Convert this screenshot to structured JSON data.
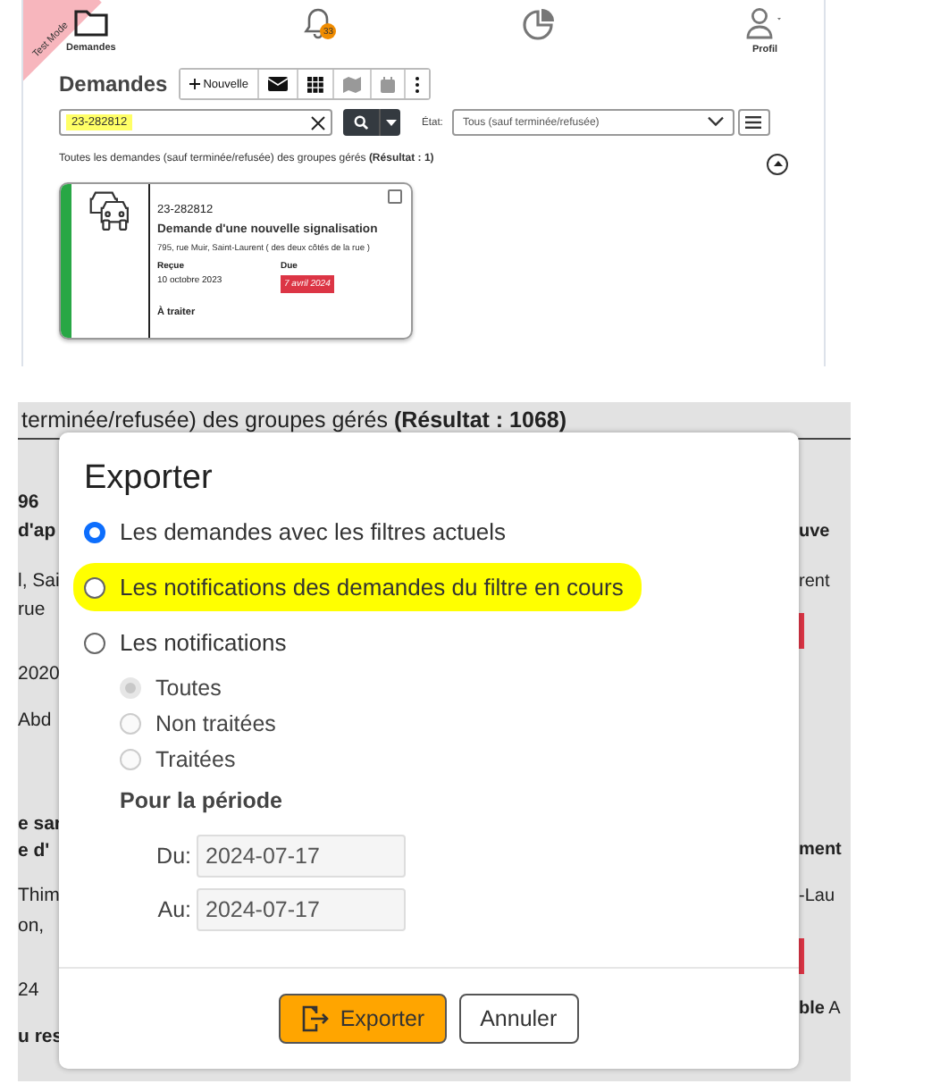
{
  "top_screen": {
    "test_mode_ribbon": "Test Mode",
    "nav": [
      {
        "kind": "folder",
        "label": "Demandes"
      },
      {
        "kind": "bell",
        "badge": "33"
      },
      {
        "kind": "chart"
      },
      {
        "kind": "user",
        "label": "Profil"
      }
    ],
    "heading": "Demandes",
    "toolbar": [
      {
        "kind": "new",
        "label": "Nouvelle",
        "disabled": false
      },
      {
        "kind": "mail",
        "disabled": false
      },
      {
        "kind": "grid",
        "disabled": false
      },
      {
        "kind": "map",
        "disabled": true
      },
      {
        "kind": "calendar",
        "disabled": true
      },
      {
        "kind": "more",
        "disabled": false
      }
    ],
    "search": {
      "value": "23-282812",
      "highlighted": true
    },
    "state_filter": {
      "label": "État:",
      "value": "Tous (sauf terminée/refusée)"
    },
    "summary": "Toutes les demandes (sauf terminée/refusée) des groupes gérés **(Résultat : 1)**",
    "cards": [
      {
        "number": "23-282812",
        "title": "Demande d'une nouvelle signalisation",
        "address": "795, rue Muir, Saint-Laurent ( des deux côtés de la rue )",
        "received_label": "Reçue",
        "received": "10 octobre 2023",
        "due_label": "Due",
        "due": "7 avril 2024",
        "overdue": true,
        "status": "À traiter",
        "checked": false,
        "color": "#28a745"
      }
    ]
  },
  "bottom_screen": {
    "summary": "terminée/refusée) des groupes gérés **(Résultat : 1068)**",
    "left_fragments": [
      {
        "kind": "text",
        "text": "**96**"
      },
      {
        "kind": "text",
        "text": "**d'ap**"
      },
      {
        "kind": "text",
        "text": "l, Sai"
      },
      {
        "kind": "text",
        "text": "rue"
      },
      {
        "kind": "text",
        "text": "2020"
      },
      {
        "kind": "text",
        "text": "Abd"
      },
      {
        "kind": "text",
        "text": "**e sar**"
      },
      {
        "kind": "text",
        "text": "**e d'**"
      },
      {
        "kind": "text",
        "text": "Thim"
      },
      {
        "kind": "text",
        "text": "on,"
      },
      {
        "kind": "text",
        "text": "24"
      },
      {
        "kind": "text",
        "text": "**u res**"
      }
    ],
    "right_fragments": [
      {
        "kind": "text",
        "text": "**uve**"
      },
      {
        "kind": "text",
        "text": "rent"
      },
      {
        "kind": "badge"
      },
      {
        "kind": "text",
        "text": "**ment**"
      },
      {
        "kind": "text",
        "text": "-Lau"
      },
      {
        "kind": "badge"
      },
      {
        "kind": "text",
        "text": "**ble** A"
      }
    ],
    "dialog": {
      "title": "Exporter",
      "options": [
        {
          "label": "Les demandes avec les filtres actuels",
          "selected": true,
          "highlighted": false
        },
        {
          "label": "Les notifications des demandes du filtre en cours",
          "selected": false,
          "highlighted": true
        },
        {
          "label": "Les notifications",
          "selected": false,
          "highlighted": false
        }
      ],
      "sub_options": [
        {
          "label": "Toutes",
          "selected": true,
          "disabled": true
        },
        {
          "label": "Non traitées",
          "selected": false,
          "disabled": true
        },
        {
          "label": "Traitées",
          "selected": false,
          "disabled": true
        }
      ],
      "period_title": "Pour la période",
      "dates": [
        {
          "label": "Du:",
          "value": "2024-07-17",
          "disabled": true
        },
        {
          "label": "Au:",
          "value": "2024-07-17",
          "disabled": true
        }
      ],
      "buttons": [
        {
          "kind": "primary",
          "label": "Exporter"
        },
        {
          "kind": "secondary",
          "label": "Annuler"
        }
      ]
    }
  }
}
